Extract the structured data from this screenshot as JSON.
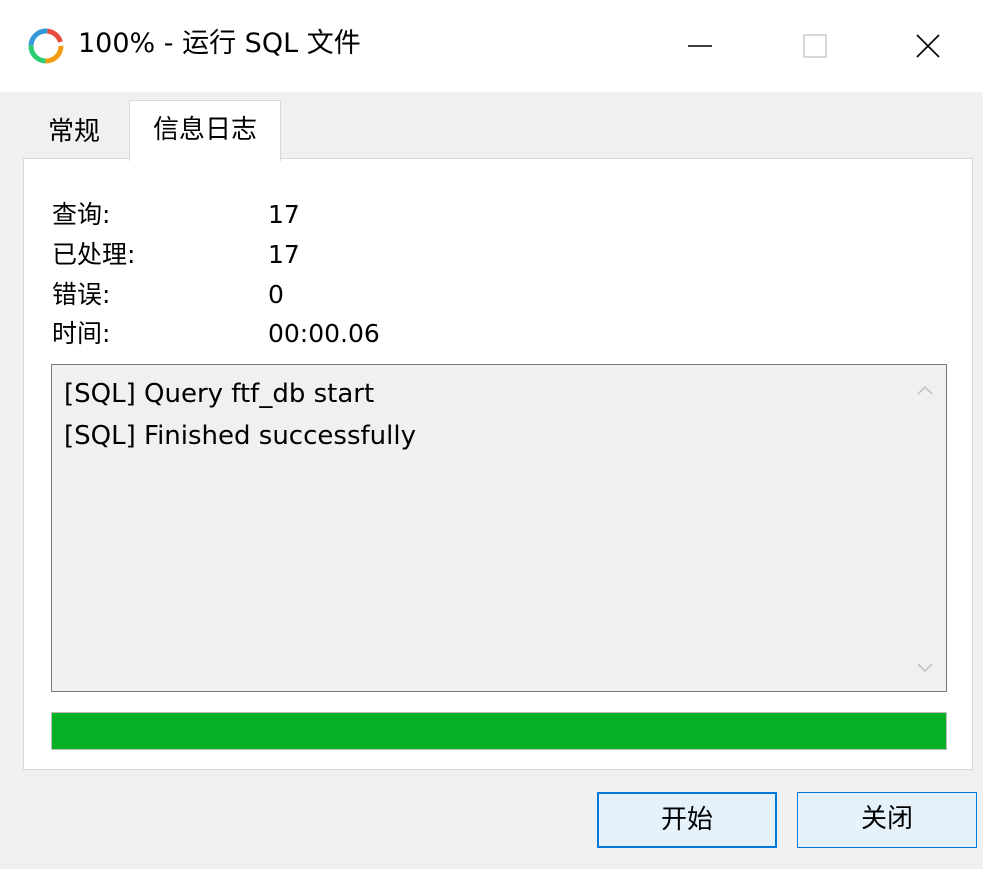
{
  "window": {
    "title": "100% - 运行 SQL 文件",
    "icon": "navicat-app-icon",
    "controls": {
      "minimize": "minimize-icon",
      "maximize": "maximize-icon",
      "close": "close-icon"
    }
  },
  "tabs": [
    {
      "label": "常规",
      "active": false
    },
    {
      "label": "信息日志",
      "active": true
    }
  ],
  "stats": [
    {
      "label": "查询:",
      "value": "17"
    },
    {
      "label": "已处理:",
      "value": "17"
    },
    {
      "label": "错误:",
      "value": "0"
    },
    {
      "label": "时间:",
      "value": "00:00.06"
    }
  ],
  "log": {
    "lines": [
      "[SQL] Query ftf_db start",
      "[SQL] Finished successfully"
    ]
  },
  "progress": {
    "percent": 100,
    "color": "#06b025"
  },
  "buttons": {
    "start": "开始",
    "close": "关闭"
  },
  "colors": {
    "accent": "#0078d7",
    "progress": "#06b025"
  }
}
